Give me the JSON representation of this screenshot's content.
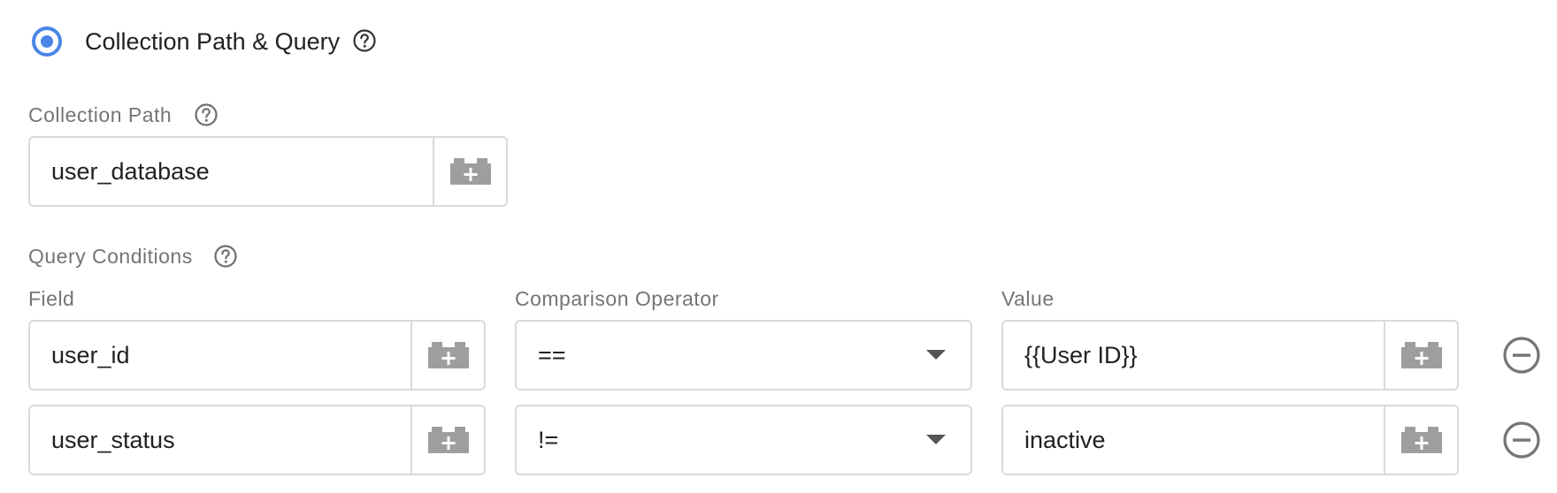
{
  "mode": {
    "selected_label": "Collection Path & Query",
    "help_icon": "help-circle-icon"
  },
  "collection_path": {
    "label": "Collection Path",
    "value": "user_database",
    "variable_icon": "lego-block-plus-icon"
  },
  "query_conditions": {
    "label": "Query Conditions",
    "columns": {
      "field": "Field",
      "operator": "Comparison Operator",
      "value": "Value"
    },
    "rows": [
      {
        "field": "user_id",
        "operator": "==",
        "value": "{{User ID}}"
      },
      {
        "field": "user_status",
        "operator": "!=",
        "value": "inactive"
      }
    ],
    "remove_icon": "minus-circle-icon",
    "dropdown_icon": "caret-down-icon"
  },
  "colors": {
    "accent": "#4a86e8",
    "label_gray": "#757575",
    "border": "#dadada",
    "icon_gray": "#9e9e9e"
  }
}
